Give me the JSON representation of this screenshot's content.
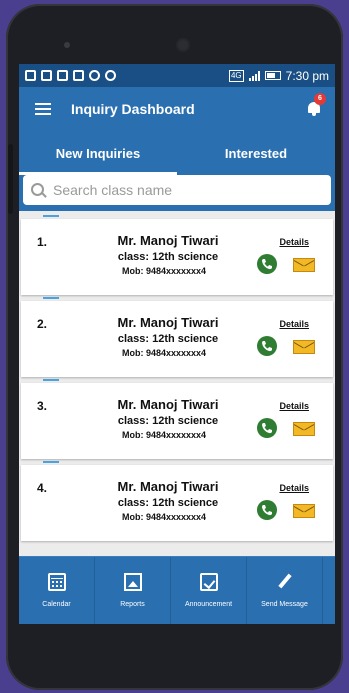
{
  "statusbar": {
    "network": "4G",
    "time": "7:30 pm"
  },
  "appbar": {
    "title": "Inquiry Dashboard",
    "notification_count": "6"
  },
  "tabs": [
    {
      "label": "New Inquiries",
      "active": true
    },
    {
      "label": "Interested",
      "active": false
    }
  ],
  "search": {
    "placeholder": "Search class name"
  },
  "inquiries": [
    {
      "index": "1.",
      "name": "Mr. Manoj Tiwari",
      "class": "class: 12th science",
      "mobile": "Mob: 9484xxxxxxx4",
      "details_label": "Details"
    },
    {
      "index": "2.",
      "name": "Mr. Manoj Tiwari",
      "class": "class: 12th science",
      "mobile": "Mob: 9484xxxxxxx4",
      "details_label": "Details"
    },
    {
      "index": "3.",
      "name": "Mr. Manoj Tiwari",
      "class": "class: 12th science",
      "mobile": "Mob: 9484xxxxxxx4",
      "details_label": "Details"
    },
    {
      "index": "4.",
      "name": "Mr. Manoj Tiwari",
      "class": "class: 12th science",
      "mobile": "Mob: 9484xxxxxxx4",
      "details_label": "Details"
    }
  ],
  "bottom_nav": [
    {
      "label": "Calendar",
      "icon": "calendar-icon"
    },
    {
      "label": "Reports",
      "icon": "image-icon"
    },
    {
      "label": "Announcement",
      "icon": "checklist-icon"
    },
    {
      "label": "Send Message",
      "icon": "pen-icon"
    }
  ],
  "colors": {
    "primary": "#2a6fb0",
    "statusbar": "#1a4f86",
    "call": "#2e7d32",
    "mail": "#f2b825",
    "badge": "#e53935"
  }
}
